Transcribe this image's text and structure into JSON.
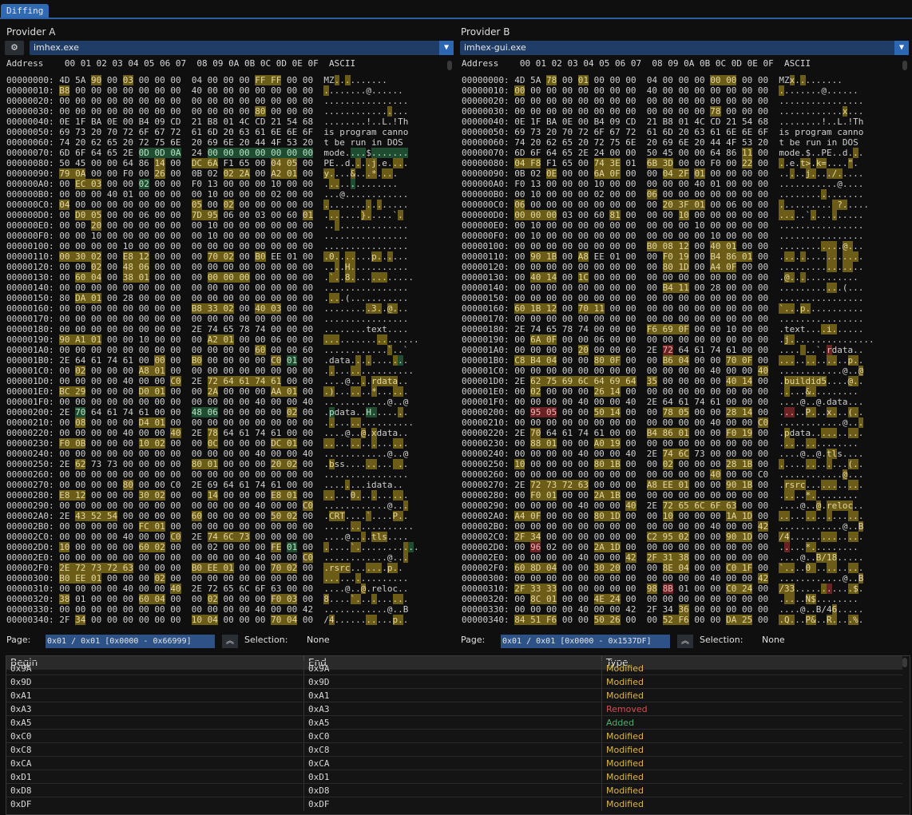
{
  "tab": "Diffing",
  "provider_a": {
    "label": "Provider A",
    "file": "imhex.exe",
    "page_label": "Page:",
    "page": "0x01 / 0x01 [0x0000 - 0x66999]",
    "selection_label": "Selection:",
    "selection": "None"
  },
  "provider_b": {
    "label": "Provider B",
    "file": "imhex-gui.exe",
    "page_label": "Page:",
    "page": "0x01 / 0x01 [0x0000 - 0x1537DF]",
    "selection_label": "Selection:",
    "selection": "None"
  },
  "hex_header": "Address    00 01 02 03 04 05 06 07  08 09 0A 0B 0C 0D 0E 0F  ASCII",
  "view_a": [
    "00000000: 4D 5A [90] 00 [03] 00 00 00  04 00 00 00 [FF FF] 00 00  MZ[.].[.].......",
    "00000010: [B8] 00 00 00 00 00 00 00  40 00 00 00 00 00 00 00  [.].......@......",
    "00000020: 00 00 00 00 00 00 00 00  00 00 00 00 00 00 00 00  ................",
    "00000030: 00 00 00 00 00 00 00 00  00 00 00 00 [80] 00 00 00  ............[.]...",
    "00000040: 0E 1F BA 0E 00 B4 09 CD  21 B8 01 4C CD 21 54 68  ........!..L.!Th",
    "00000050: 69 73 20 70 72 6F 67 72  61 6D 20 63 61 6E 6E 6F  is program canno",
    "00000060: 74 20 62 65 20 72 75 6E  20 69 6E 20 44 4F 53 20  t be run in DOS ",
    "00000070: 6D 6F 64 65 2E {0D 0D 0A}  24 {00 00 00 00 00 00 00}  mode.{...}${.......}",
    "00000080: 50 45 00 00 64 86 [14] 00  [DC 6A] F1 65 00 [04 05] 00  PE..d.[.].[.j].e.[..].",
    "00000090: [79 0A] 00 00 F0 00 [26] 00  0B 02 [02 2A] 00 [A2 01] 00  [y.]...[&]..[.*].[..].",
    "000000A0: 00 [EC 03] 00 00 {02} 00 00  F0 13 00 00 00 10 00 00  .[..]..{.}........",
    "000000B0: 00 00 00 40 01 00 00 00  00 10 00 00 00 02 00 00  ...@............",
    "000000C0: [04] 00 00 00 00 00 00 00  [05] 00 [02] 00 00 00 00 00  [.].......[.].[.].....",
    "000000D0: 00 [D0 05] 00 00 06 00 00  [7D 95] 06 00 03 00 60 [01]  .[..]....[}.]....`[.]",
    "000000E0: 00 00 [20] 00 00 00 00 00  00 10 00 00 00 00 00 00  ..[ ].............",
    "000000F0: 00 00 10 00 00 00 00 00  00 10 00 00 00 00 00 00  ................",
    "00000100: 00 00 00 00 10 00 00 00  00 00 00 00 00 00 00 00  ................",
    "00000110: [00 30 02] 00 [E8 12] 00 00  00 [70 02] 00 [B0] EE 01 00  [.0.].[..]...[p.].[.]...",
    "00000120: 00 00 [02] 00 [48 06] 00 00  00 00 00 00 00 00 00 00  ..[.].[H.]..........",
    "00000130: 00 [60 04] 00 [38 01] 00 00  00 [00 00 00] 00 00 00 00  .[`.].[8.]...[...].....",
    "00000140: 00 00 00 00 00 00 00 00  00 00 00 00 00 00 00 00  ................",
    "00000150: 80 [DA 01] 00 28 00 00 00  00 00 00 00 00 00 00 00  .[..].(...........",
    "00000160: 00 00 00 00 00 00 00 00  [B8 33 02] 00 [40 03] 00 00  ........[.3.].[@.]..",
    "00000170: 00 00 00 00 00 00 00 00  00 00 00 00 00 00 00 00  ................",
    "00000180: 00 00 00 00 00 00 00 00  2E 74 65 78 74 00 00 00  ........text....",
    "00000190: [90 A1 01] 00 00 10 00 00  00 [A2 01] 00 00 06 00 00  [...].......[..]......",
    "000001A0: 00 00 00 00 00 00 00 00  00 00 00 00 [60] 00 00 60  ............[`]..`",
    "000001B0: 2E 64 61 74 61 00 [00] 00  [B0] 00 00 00 00 [C0] {01} 00  .data.[.].[.]....[.]{.}.",
    "000001C0: 00 [02] 00 00 00 [A8 01] 00  00 00 00 00 00 00 00 00  .[.]...[..]..........",
    "000001D0: 00 00 00 00 40 00 00 [C0]  2E [72 64 61 74 61] 00 00  ....@..[.].[rdata]..",
    "000001E0: [BC 29] 00 00 00 [D0 01] 00  00 [2A] 00 00 00 [AA 01] 00  [.)]...[..]..[*]...[..].",
    "000001F0: 00 00 00 00 00 00 00 00  00 00 00 00 40 00 00 40  ............@..@",
    "00000200: 2E {70} 64 61 74 61 00 00  {48 06} 00 00 00 00 [02] 00  .{p}data..{H.}....[.].",
    "00000210: 00 [08] 00 00 00 [D4 01] 00  00 00 00 00 00 00 00 00  .[.]...[..]..........",
    "00000220: 00 00 00 00 40 00 00 [40]  2E [78] 64 61 74 61 00 00  ....@..[@].[x]data..",
    "00000230: [F0 0B] 00 00 00 [10 02] 00  00 [0C] 00 00 00 [DC 01] 00  [..]...[..]..[.]...[..].",
    "00000240: 00 00 00 00 00 00 00 00  00 00 00 00 40 00 00 40  ............@..@",
    "00000250: 2E [62] 73 73 00 00 00 00  [80 01] 00 00 00 [20 02] 00  .[b]ss....[..]...[ .].",
    "00000260: 00 00 00 00 00 00 00 00  00 00 00 00 00 00 00 00  ................",
    "00000270: 00 00 00 00 [80] 00 00 C0  2E 69 64 61 74 61 00 00  ....[.]...idata..",
    "00000280: [E8 12] 00 00 00 [30 02] 00  00 [14] 00 00 00 [E8 01] 00  [..]...[0.]..[.]...[..].",
    "00000290: 00 00 00 00 00 00 00 00  00 00 00 00 40 00 00 [C0]  ............@..[.]",
    "000002A0: 2E [43 52 54] 00 00 00 00  [60] 00 00 00 00 [50 02] 00  .[CRT]....[`]....[P.].",
    "000002B0: 00 00 00 00 00 [FC 01] 00  00 00 00 00 00 00 00 00  .....[..]..........",
    "000002C0: 00 00 00 00 40 00 00 [C0]  2E [74 6C 73] 00 00 00 00  ....@..[.].[tls]....",
    "000002D0: [10] 00 00 00 00 [60 02] 00  00 02 00 00 00 [FE] {01} 00  [.]....[`.]........[.]{.}.",
    "000002E0: 00 00 00 00 00 00 00 00  00 00 00 00 40 00 00 [C0]  ............@..[.]",
    "000002F0: [2E 72 73 72 63] 00 00 00  [B0 EE 01] 00 00 [70 02] 00  [.rsrc]...[...].[p.].",
    "00000300: [B0 EE 01] 00 00 00 [02] 00  00 00 00 00 00 00 00 00  [...]...[.].........",
    "00000310: 00 00 00 00 40 00 00 [40]  2E 72 65 6C 6F 63 00 00  ....@..[@].reloc..",
    "00000320: [38] 01 00 00 00 [60 04] 00  00 [02] 00 00 00 [F0 03] 00  [8]....[`.]..[.]...[..].",
    "00000330: 00 00 00 00 00 00 00 00  00 00 00 00 40 00 00 42  ............@..B",
    "00000340: 2F [34] 00 00 00 00 00 00  [10 04] 00 00 00 [70 04] 00  /[4]......[..]...[p.]."
  ],
  "view_b": [
    "00000000: 4D 5A [78] 00 [01] 00 00 00  04 00 00 00 [00 00] 00 00  MZ[x].[.].......",
    "00000010: [00] 00 00 00 00 00 00 00  40 00 00 00 00 00 00 00  [.].......@......",
    "00000020: 00 00 00 00 00 00 00 00  00 00 00 00 00 00 00 00  ................",
    "00000030: 00 00 00 00 00 00 00 00  00 00 00 00 [78] 00 00 00  ............[x]...",
    "00000040: 0E 1F BA 0E 00 B4 09 CD  21 B8 01 4C CD 21 54 68  ........!..L.!Th",
    "00000050: 69 73 20 70 72 6F 67 72  61 6D 20 63 61 6E 6E 6F  is program canno",
    "00000060: 74 20 62 65 20 72 75 6E  20 69 6E 20 44 4F 53 20  t be run in DOS ",
    "00000070: 6D 6F 64 65 2E 24 00 00  50 45 00 00 64 86 [11] 00  mode.$..PE..d.[.].",
    "00000080: [04 F8] F1 65 00 [74 3E] 01  [6B 3D] 00 00 F0 00 [22] 00  [.].e.[t>].[k=]....[\"].",
    "00000090: 0B 02 [0E] 00 00 [6A 0F] 00  00 [04 2F] [01] 00 00 00 00  ..[.]..[j.]..[./][.]....",
    "000000A0: F0 13 00 00 00 10 00 00  00 00 00 40 01 00 00 00  ...........@....",
    "000000B0: 00 10 00 00 00 02 00 00  [06] 00 00 00 00 00 00 00  ........[.].......",
    "000000C0: [06] 00 00 00 00 00 00 00  00 [20 3F 01] 00 06 00 00  [.].........[ ?.]....",
    "000000D0: [00 00 00] 03 00 60 [81] 00  00 00 [10] 00 00 00 00 00  [...]..`[.]...[.].....",
    "000000E0: 00 10 00 00 00 00 00 00  00 00 00 10 00 00 00 00  ................",
    "000000F0: 00 10 00 00 00 00 00 00  00 00 00 00 10 00 00 00  ................",
    "00000100: 00 00 00 00 00 00 00 00  [B0 08 12] 00 [40 01] 00 00  ........[...].[@.]..",
    "00000110: 00 [90 1B] 00 [A8] EE 01 00  00 [F0 19] 00 [B4 86 01] 00  .[..].[.]....[..].[...].",
    "00000120: 00 00 00 00 00 00 00 00  00 [80 1D] 00 [A4 0F] 00 00  .........[..].[..]..",
    "00000130: 00 [40 14] 00 [1C] 00 00 00  00 00 00 00 00 00 00 00  .[@.].[.]..........",
    "00000140: 00 00 00 00 00 00 00 00  00 [B4 11] 00 28 00 00 00  .........[..].(...",
    "00000150: 00 00 00 00 00 00 00 00  00 00 00 00 00 00 00 00  ................",
    "00000160: [60 1B 12] 00 [70 11] 00 00  00 00 00 00 00 00 00 00  [`..].[p.]..........",
    "00000170: 00 00 00 00 00 00 00 00  00 00 00 00 00 00 00 00  ................",
    "00000180: 2E 74 65 78 74 00 00 00  [F6 69 0F] 00 00 10 00 00  .text...[.i.].....",
    "00000190: 00 [6A 0F] 00 00 06 00 00  00 00 00 00 00 00 00 00  .[j.]...............",
    "000001A0: 00 00 00 00 [20] 00 00 60  2E (72) 64 61 74 61 00 00  ....[ ]..`.(r)data..",
    "000001B0: [C8 B4 04] 00 00 [80 0F] 00  00 [B6 04] 00 00 [70 0F] 00  [...]..[..]..[..]..[p.].",
    "000001C0: 00 00 00 00 00 00 00 00  00 00 00 00 40 00 00 [40]  ............@..[@]",
    "000001D0: 2E [62 75 69 6C 64 69 64]  [35] 00 00 00 00 [40 14] 00  .[buildid5]....[@.].",
    "000001E0: 00 [02] 00 00 00 [26 14] 00  00 00 00 00 00 00 00 00  .[.]...[&.]........",
    "000001F0: 00 00 00 00 40 00 00 40  2E 64 61 74 61 00 00 00  ....@..@.data...",
    "00000200: 00 (95 05) 00 00 [50 14] 00  00 [78 05] 00 00 [28 14] 00  .(..)..[P.]..[x.]..[(.].",
    "00000210: 00 00 00 00 00 00 00 00  00 00 00 00 40 00 00 [C0]  ............@..[.]",
    "00000220: 2E [70] 64 61 74 61 00 00  [B4 86 01] 00 00 [F0 19] 00  .[p]data..[...]..[..].",
    "00000230: 00 [88 01] 00 00 [A0 19] 00  00 00 00 00 00 00 00 00  .[..]..[..]........",
    "00000240: 00 00 00 00 40 00 00 40  2E [74 6C] 73 00 00 00 00  ....@..@.[tl]s....",
    "00000250: [10] 00 00 00 00 [80 1B] 00  00 [02] 00 00 00 [28 1B] 00  [.]....[..]..[.]...[(.].",
    "00000260: 00 00 00 00 00 00 00 00  00 00 00 00 [40] 00 00 C0  ............[@]...",
    "00000270: 2E [72 73 72 63] 00 00 00  [A8 EE 01] 00 00 [90 1B] 00  .[rsrc]...[...]..[..].",
    "00000280: 00 [F0 01] 00 00 [2A 1B] 00  00 00 00 00 00 00 00 00  .[..]..[*.]........",
    "00000290: 00 00 00 00 40 00 00 [40]  2E [72 65 6C 6F 63] 00 00  ....@..[@].[reloc]..",
    "000002A0: [A4 0F] 00 00 00 [80 1D] 00  00 [10] 00 00 00 [1A 1D] 00  [..]...[..]..[.]...[..].",
    "000002B0: 00 00 00 00 00 00 00 00  00 00 00 00 40 00 00 [42]  ............@..[B]",
    "000002C0: [2F 34] 00 00 00 00 00 00  [C2 95 02] 00 00 [90 1D] 00  [/4]......[...]..[..].",
    "000002D0: 00 (96) 02 00 00 [2A 1D] 00  00 00 00 00 00 00 00 00  .(.)...[*.]........",
    "000002E0: 00 00 00 00 40 00 00 [42]  [2F 31 38] 00 00 00 00 00  ....@..[B][/18].....",
    "000002F0: [60 8D 04] 00 00 [30 20] 00  00 [8E 04] 00 00 [C0 1F] 00  [`..]..[0 ]..[..]..[..].",
    "00000300: 00 00 00 00 00 00 00 00  00 00 00 00 40 00 00 [42]  ............@..[B]",
    "00000310: [2F 33 33] 00 00 00 00 00  [98] (8B) 01 00 00 [C0 24] 00  [/33].....[.](.)...[.$].",
    "00000320: 00 [8C 01] 00 00 [4E 24] 00  00 00 00 00 00 00 00 00  .[..]..[N$]........",
    "00000330: 00 00 00 00 40 00 00 42  2F 34 [36] 00 00 00 00 00  ....@..B/4[6].....",
    "00000340: [84 51 F6] 00 00 [50 26] 00  00 [52 F6] 00 00 [DA 25] 00  [.Q.]..[P&]..[R.]..[.%]."
  ],
  "table": {
    "headers": [
      "Begin",
      "End",
      "Type"
    ],
    "rows": [
      {
        "begin": "0x9A",
        "end": "0x9A",
        "type": "Modified",
        "color": "#e0b44b"
      },
      {
        "begin": "0x9D",
        "end": "0x9D",
        "type": "Modified",
        "color": "#e0b44b"
      },
      {
        "begin": "0xA1",
        "end": "0xA1",
        "type": "Modified",
        "color": "#e0b44b"
      },
      {
        "begin": "0xA3",
        "end": "0xA3",
        "type": "Removed",
        "color": "#d05050"
      },
      {
        "begin": "0xA5",
        "end": "0xA5",
        "type": "Added",
        "color": "#4caf6a"
      },
      {
        "begin": "0xC0",
        "end": "0xC0",
        "type": "Modified",
        "color": "#e0b44b"
      },
      {
        "begin": "0xC8",
        "end": "0xC8",
        "type": "Modified",
        "color": "#e0b44b"
      },
      {
        "begin": "0xCA",
        "end": "0xCA",
        "type": "Modified",
        "color": "#e0b44b"
      },
      {
        "begin": "0xD1",
        "end": "0xD1",
        "type": "Modified",
        "color": "#e0b44b"
      },
      {
        "begin": "0xD8",
        "end": "0xD8",
        "type": "Modified",
        "color": "#e0b44b"
      },
      {
        "begin": "0xDF",
        "end": "0xDF",
        "type": "Modified",
        "color": "#e0b44b"
      }
    ]
  },
  "icons": {
    "settings": "gear-icon",
    "dropdown": "triangle-down-icon",
    "page_up": "double-chevron-up-icon"
  }
}
